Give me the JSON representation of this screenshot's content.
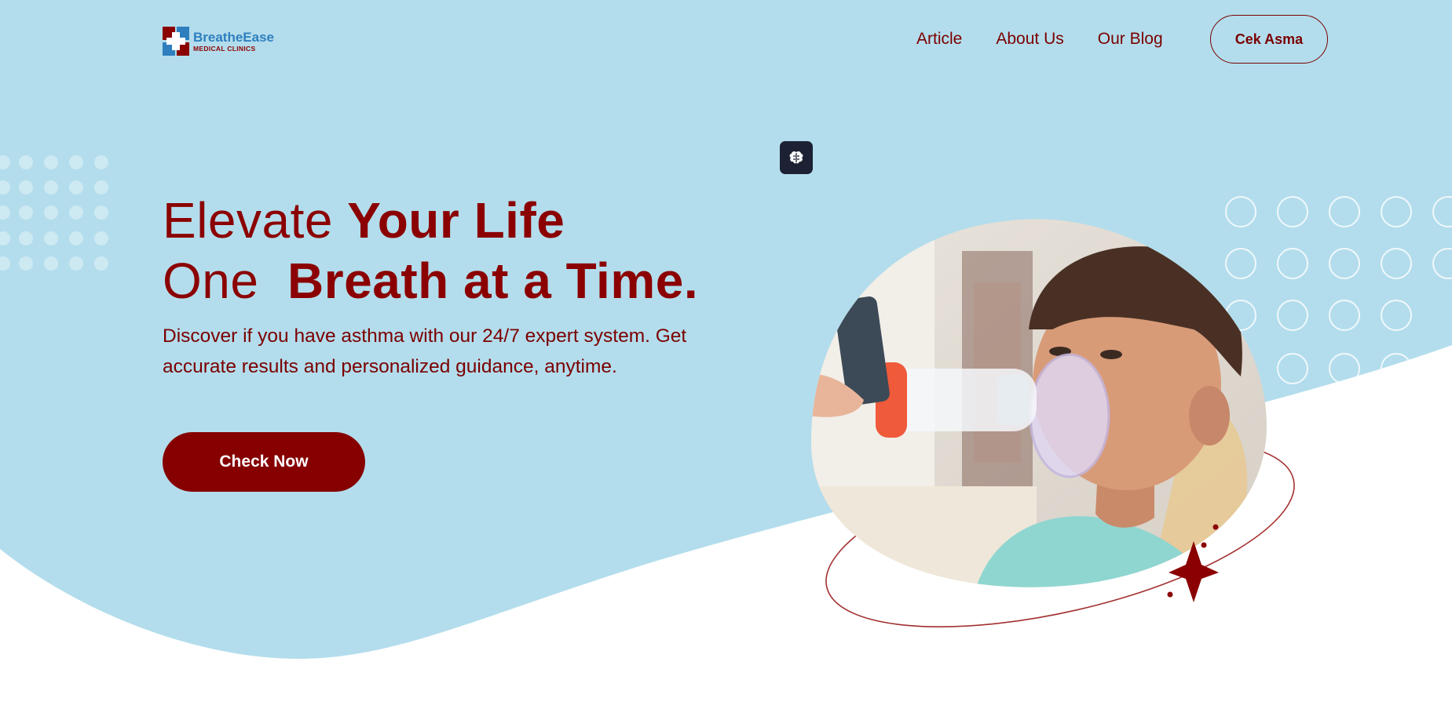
{
  "brand": {
    "name": "BreatheEase",
    "subtitle": "MEDICAL CLINICS",
    "logo_icon": "medical-cross-logo",
    "colors": {
      "primary_red": "#8b0000",
      "brand_blue": "#2f7fbf",
      "sky": "#b3ddec"
    }
  },
  "nav": {
    "items": [
      {
        "label": "Article"
      },
      {
        "label": "About Us"
      },
      {
        "label": "Our Blog"
      }
    ],
    "cta_label": "Cek Asma"
  },
  "floating": {
    "icon": "brain-icon"
  },
  "hero": {
    "line1_light": "Elevate ",
    "line1_bold": "Your Life",
    "line2_light": "One  ",
    "line2_bold": "Breath at a Time.",
    "description": "Discover if you have asthma with our 24/7 expert system. Get accurate results and personalized guidance, anytime.",
    "button_label": "Check Now"
  },
  "illustration": {
    "icon": "child-with-inhaler-photo",
    "accent_icon": "sparkle-star-icon"
  }
}
